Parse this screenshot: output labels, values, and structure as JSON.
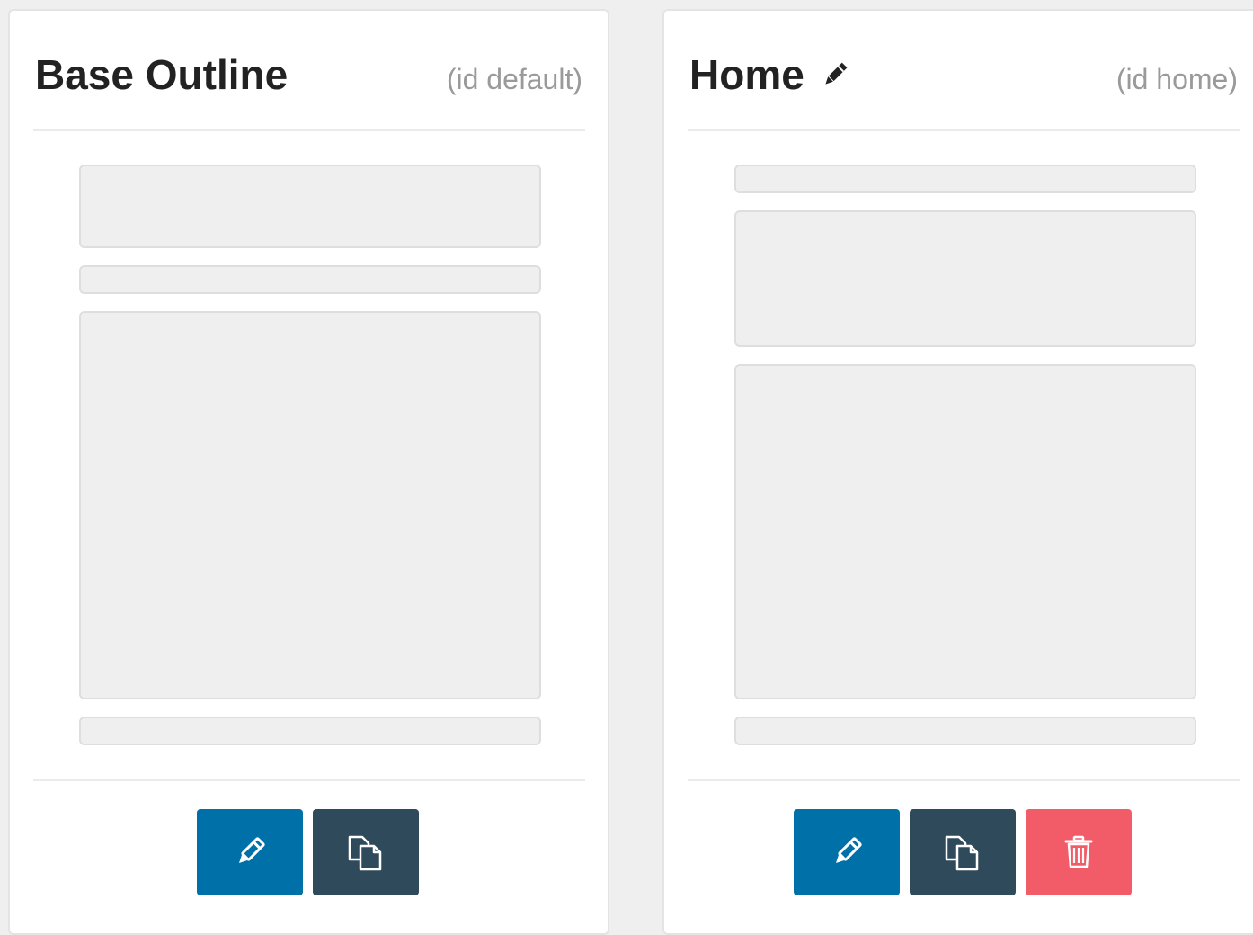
{
  "cards": [
    {
      "title": "Base Outline",
      "id_label": "(id default)",
      "has_title_edit_icon": false,
      "actions": [
        "edit-icon",
        "copy-icon"
      ]
    },
    {
      "title": "Home",
      "id_label": "(id home)",
      "has_title_edit_icon": true,
      "title_icon": "pencil-icon",
      "actions": [
        "edit-icon",
        "copy-icon",
        "trash-icon"
      ]
    }
  ],
  "colors": {
    "edit_button": "#0071a8",
    "copy_button": "#2f4a5a",
    "delete_button": "#f25c69",
    "placeholder_block": "#efefef"
  }
}
